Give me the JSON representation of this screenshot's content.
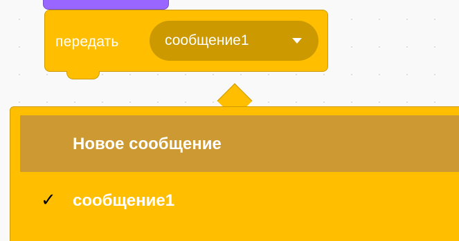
{
  "block": {
    "label": "передать",
    "selected_message": "сообщение1"
  },
  "menu": {
    "items": [
      {
        "label": "Новое сообщение",
        "checked": false,
        "highlighted": true
      },
      {
        "label": "сообщение1",
        "checked": true,
        "check_glyph": "✓"
      }
    ]
  },
  "colors": {
    "events": "#ffbf00",
    "events_dark": "#cc9900",
    "looks": "#9966ff",
    "menu_highlight": "#cc9933"
  },
  "icons": {
    "dropdown": "caret-down-icon",
    "check": "checkmark-icon"
  }
}
